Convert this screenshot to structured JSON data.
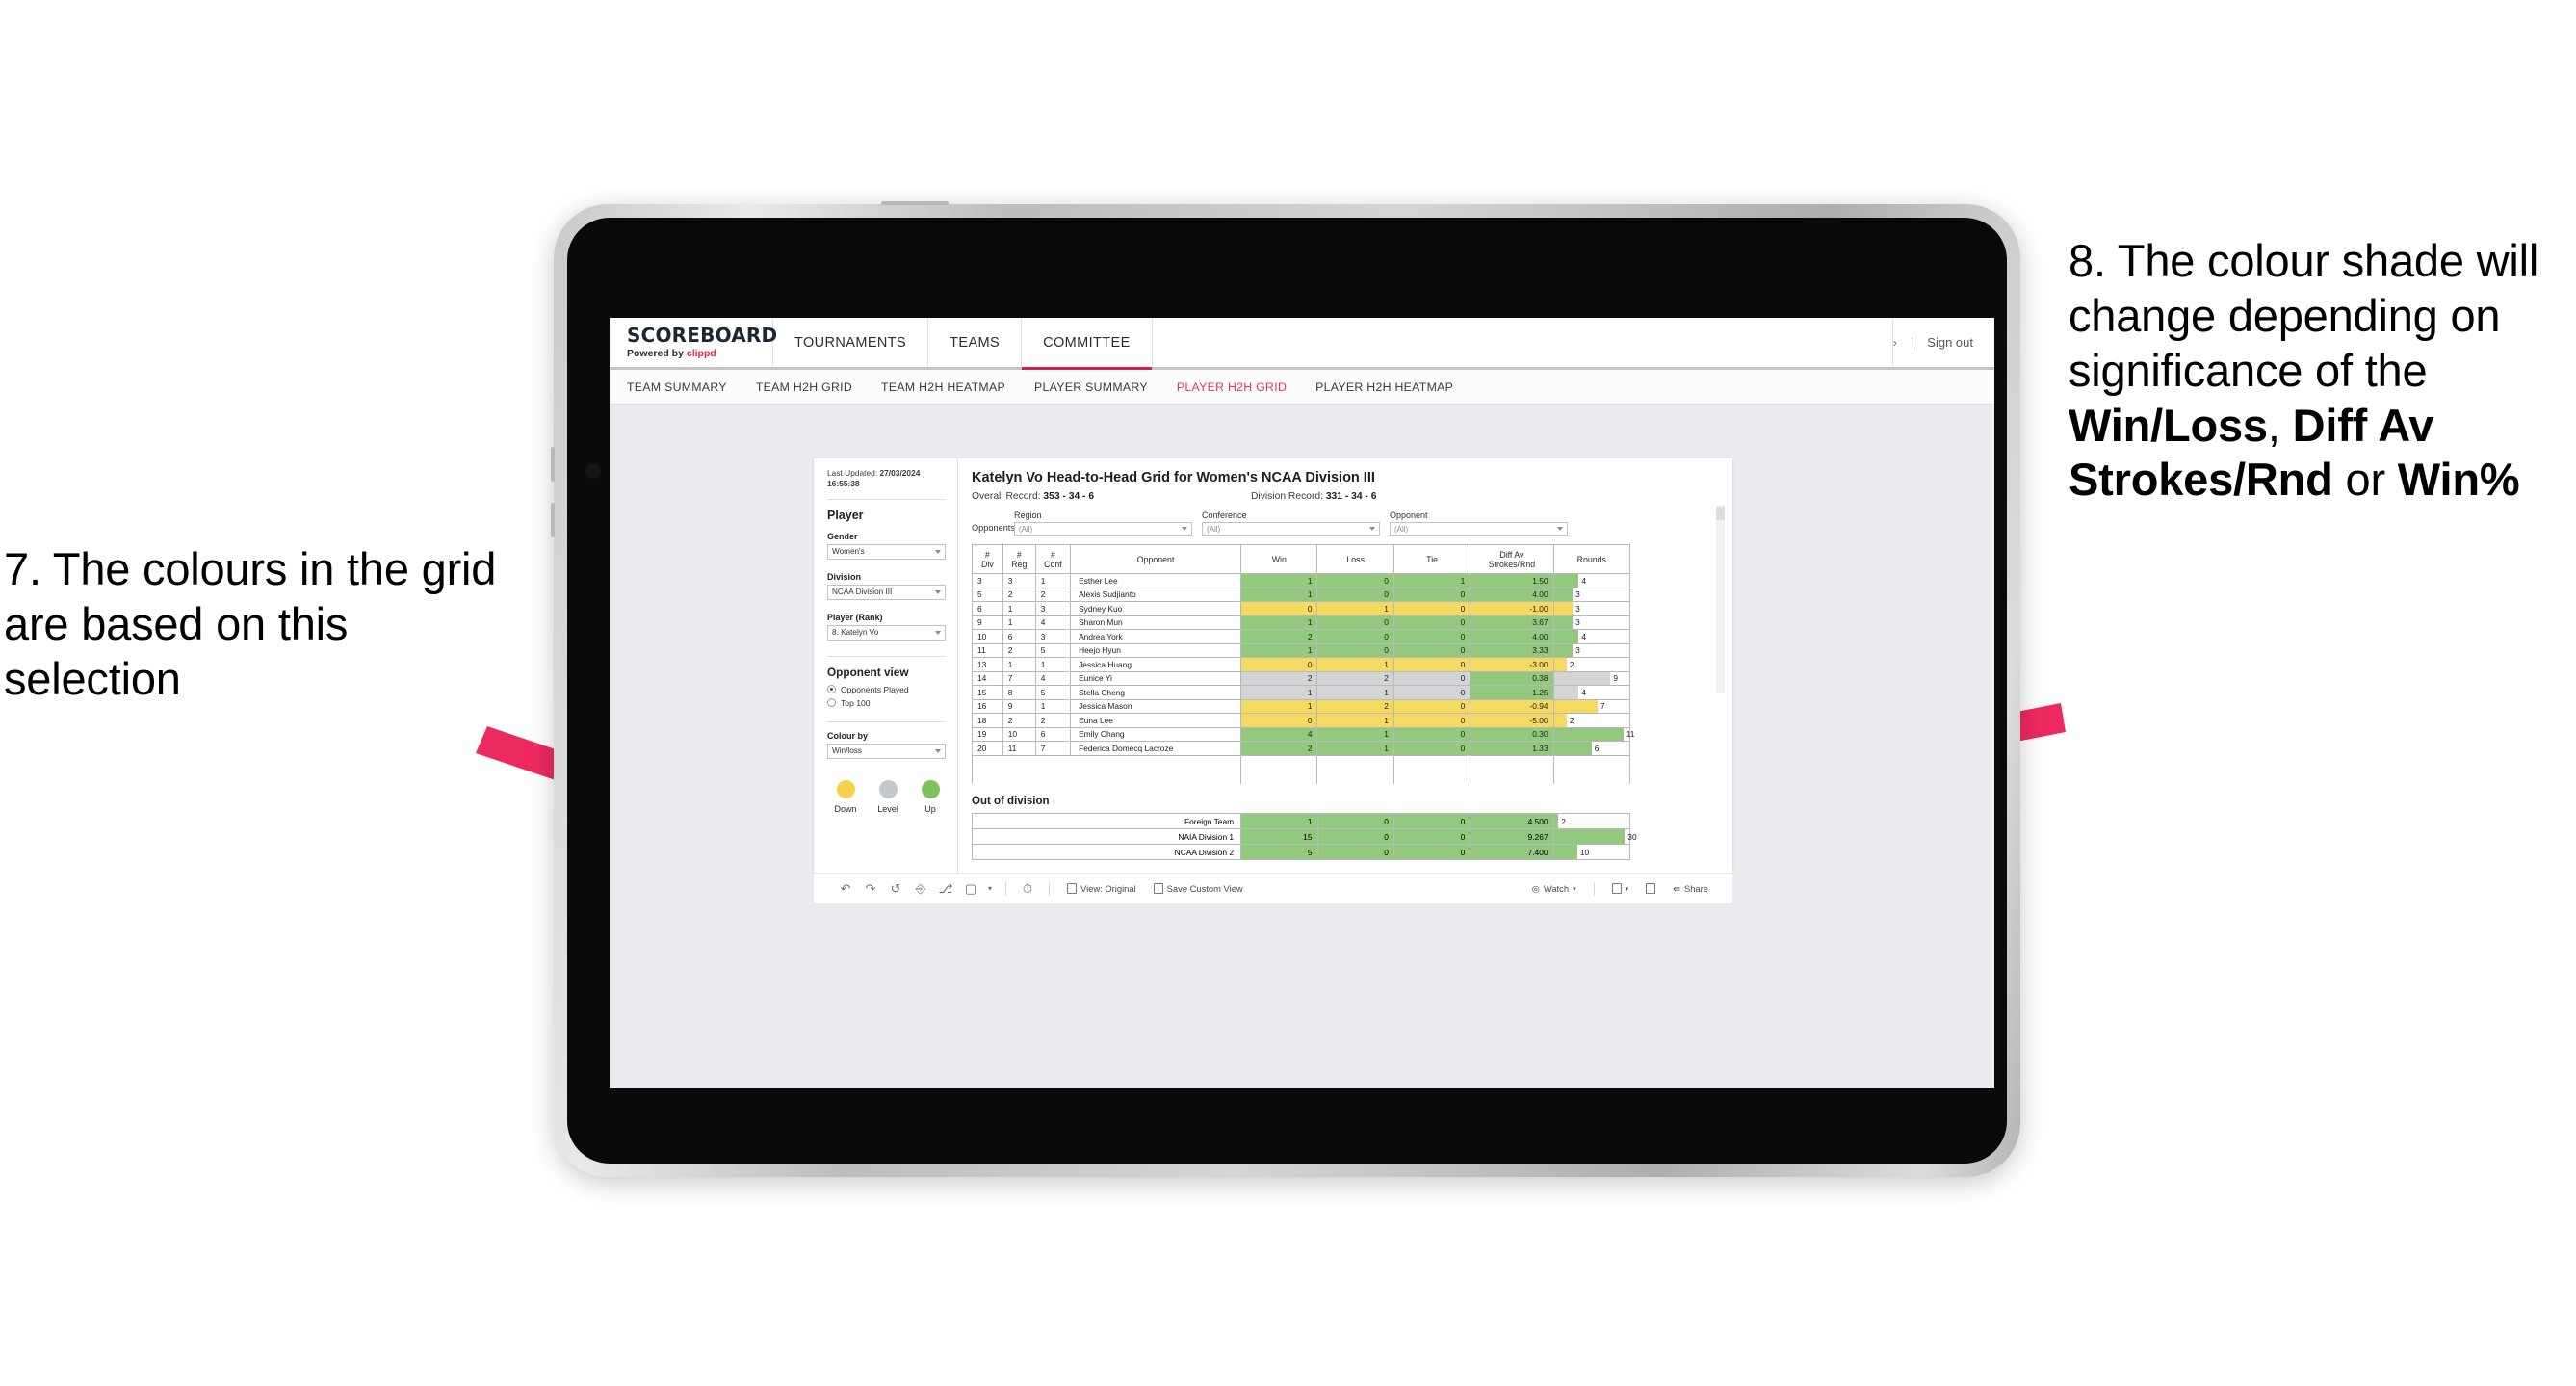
{
  "annotations": {
    "left": {
      "prefix": "7. The colours in the grid are based on this selection"
    },
    "right": {
      "p1": "8. The colour shade will change depending on significance of the ",
      "b1": "Win/Loss",
      "sep1": ", ",
      "b2": "Diff Av Strokes/Rnd",
      "sep2": " or ",
      "b3": "Win%"
    },
    "arrow_color": "#ED2A5F"
  },
  "brand": {
    "title": "SCOREBOARD",
    "powered_prefix": "Powered by ",
    "powered_name": "clippd"
  },
  "topnav": {
    "items": [
      {
        "label": "TOURNAMENTS",
        "active": false
      },
      {
        "label": "TEAMS",
        "active": false
      },
      {
        "label": "COMMITTEE",
        "active": true
      }
    ],
    "chevron": "›",
    "separator": "|",
    "signout": "Sign out"
  },
  "subnav": {
    "items": [
      {
        "label": "TEAM SUMMARY",
        "active": false
      },
      {
        "label": "TEAM H2H GRID",
        "active": false
      },
      {
        "label": "TEAM H2H HEATMAP",
        "active": false
      },
      {
        "label": "PLAYER SUMMARY",
        "active": false
      },
      {
        "label": "PLAYER H2H GRID",
        "active": true
      },
      {
        "label": "PLAYER H2H HEATMAP",
        "active": false
      }
    ]
  },
  "filters": {
    "last_updated_label": "Last Updated: ",
    "last_updated_value": "27/03/2024 16:55:38",
    "player_heading": "Player",
    "gender": {
      "label": "Gender",
      "value": "Women's"
    },
    "division": {
      "label": "Division",
      "value": "NCAA Division III"
    },
    "player_rank": {
      "label": "Player (Rank)",
      "value": "8. Katelyn Vo"
    },
    "opponent_view": {
      "heading": "Opponent view",
      "options": [
        {
          "label": "Opponents Played",
          "selected": true
        },
        {
          "label": "Top 100",
          "selected": false
        }
      ]
    },
    "colour_by": {
      "label": "Colour by",
      "value": "Win/loss"
    },
    "legend": [
      {
        "label": "Down",
        "color": "#f2d34b"
      },
      {
        "label": "Level",
        "color": "#c4c8cb"
      },
      {
        "label": "Up",
        "color": "#7fc35c"
      }
    ]
  },
  "main": {
    "title": "Katelyn Vo Head-to-Head Grid for Women's NCAA Division III",
    "overall_record_label": "Overall Record: ",
    "overall_record_value": "353 - 34 - 6",
    "division_record_label": "Division Record: ",
    "division_record_value": "331 - 34 - 6",
    "opponents_label": "Opponents:",
    "opponent_filters": [
      {
        "label": "Region",
        "value": "(All)"
      },
      {
        "label": "Conference",
        "value": "(All)"
      },
      {
        "label": "Opponent",
        "value": "(All)"
      }
    ]
  },
  "chart_data": {
    "type": "table",
    "title": "Katelyn Vo Head-to-Head Grid for Women's NCAA Division III",
    "columns": [
      "# Div",
      "# Reg",
      "# Conf",
      "Opponent",
      "Win",
      "Loss",
      "Tie",
      "Diff Av Strokes/Rnd",
      "Rounds"
    ],
    "column_header_lines": [
      [
        "#",
        "Div"
      ],
      [
        "#",
        "Reg"
      ],
      [
        "#",
        "Conf"
      ],
      [
        "Opponent"
      ],
      [
        "Win"
      ],
      [
        "Loss"
      ],
      [
        "Tie"
      ],
      [
        "Diff Av",
        "Strokes/Rnd"
      ],
      [
        "Rounds"
      ]
    ],
    "colors": {
      "up": "#92c97e",
      "down": "#f5da62",
      "level": "#d2d4d6"
    },
    "rounds_max": 12,
    "rows": [
      {
        "div": "3",
        "reg": "3",
        "conf": "1",
        "opponent": "Esther Lee",
        "win": "1",
        "loss": "0",
        "tie": "1",
        "diff": "1.50",
        "rounds": "4",
        "rounds_val": 4,
        "state": "up"
      },
      {
        "div": "5",
        "reg": "2",
        "conf": "2",
        "opponent": "Alexis Sudjianto",
        "win": "1",
        "loss": "0",
        "tie": "0",
        "diff": "4.00",
        "rounds": "3",
        "rounds_val": 3,
        "state": "up"
      },
      {
        "div": "6",
        "reg": "1",
        "conf": "3",
        "opponent": "Sydney Kuo",
        "win": "0",
        "loss": "1",
        "tie": "0",
        "diff": "-1.00",
        "rounds": "3",
        "rounds_val": 3,
        "state": "down"
      },
      {
        "div": "9",
        "reg": "1",
        "conf": "4",
        "opponent": "Sharon Mun",
        "win": "1",
        "loss": "0",
        "tie": "0",
        "diff": "3.67",
        "rounds": "3",
        "rounds_val": 3,
        "state": "up"
      },
      {
        "div": "10",
        "reg": "6",
        "conf": "3",
        "opponent": "Andrea York",
        "win": "2",
        "loss": "0",
        "tie": "0",
        "diff": "4.00",
        "rounds": "4",
        "rounds_val": 4,
        "state": "up"
      },
      {
        "div": "11",
        "reg": "2",
        "conf": "5",
        "opponent": "Heejo Hyun",
        "win": "1",
        "loss": "0",
        "tie": "0",
        "diff": "3.33",
        "rounds": "3",
        "rounds_val": 3,
        "state": "up"
      },
      {
        "div": "13",
        "reg": "1",
        "conf": "1",
        "opponent": "Jessica Huang",
        "win": "0",
        "loss": "1",
        "tie": "0",
        "diff": "-3.00",
        "rounds": "2",
        "rounds_val": 2,
        "state": "down"
      },
      {
        "div": "14",
        "reg": "7",
        "conf": "4",
        "opponent": "Eunice Yi",
        "win": "2",
        "loss": "2",
        "tie": "0",
        "diff": "0.38",
        "rounds": "9",
        "rounds_val": 9,
        "state": "level",
        "diff_state": "up"
      },
      {
        "div": "15",
        "reg": "8",
        "conf": "5",
        "opponent": "Stella Cheng",
        "win": "1",
        "loss": "1",
        "tie": "0",
        "diff": "1.25",
        "rounds": "4",
        "rounds_val": 4,
        "state": "level",
        "diff_state": "up"
      },
      {
        "div": "16",
        "reg": "9",
        "conf": "1",
        "opponent": "Jessica Mason",
        "win": "1",
        "loss": "2",
        "tie": "0",
        "diff": "-0.94",
        "rounds": "7",
        "rounds_val": 7,
        "state": "down"
      },
      {
        "div": "18",
        "reg": "2",
        "conf": "2",
        "opponent": "Euna Lee",
        "win": "0",
        "loss": "1",
        "tie": "0",
        "diff": "-5.00",
        "rounds": "2",
        "rounds_val": 2,
        "state": "down"
      },
      {
        "div": "19",
        "reg": "10",
        "conf": "6",
        "opponent": "Emily Chang",
        "win": "4",
        "loss": "1",
        "tie": "0",
        "diff": "0.30",
        "rounds": "11",
        "rounds_val": 11,
        "state": "up"
      },
      {
        "div": "20",
        "reg": "11",
        "conf": "7",
        "opponent": "Federica Domecq Lacroze",
        "win": "2",
        "loss": "1",
        "tie": "0",
        "diff": "1.33",
        "rounds": "6",
        "rounds_val": 6,
        "state": "up"
      }
    ]
  },
  "out_of_division": {
    "title": "Out of division",
    "rounds_max": 32,
    "rows": [
      {
        "name": "Foreign Team",
        "win": "1",
        "loss": "0",
        "tie": "0",
        "diff": "4.500",
        "rounds": "2",
        "rounds_val": 2,
        "state": "up"
      },
      {
        "name": "NAIA Division 1",
        "win": "15",
        "loss": "0",
        "tie": "0",
        "diff": "9.267",
        "rounds": "30",
        "rounds_val": 30,
        "state": "up"
      },
      {
        "name": "NCAA Division 2",
        "win": "5",
        "loss": "0",
        "tie": "0",
        "diff": "7.400",
        "rounds": "10",
        "rounds_val": 10,
        "state": "up"
      }
    ]
  },
  "toolbar": {
    "icons": [
      "undo-icon",
      "redo-icon",
      "revert-icon",
      "refresh-icon",
      "pause-icon",
      "shape-icon",
      "caret-icon"
    ],
    "alerts_icon": "alerts-icon",
    "view_label": "View: Original",
    "save_label": "Save Custom View",
    "watch_label": "Watch",
    "share_label": "Share"
  }
}
